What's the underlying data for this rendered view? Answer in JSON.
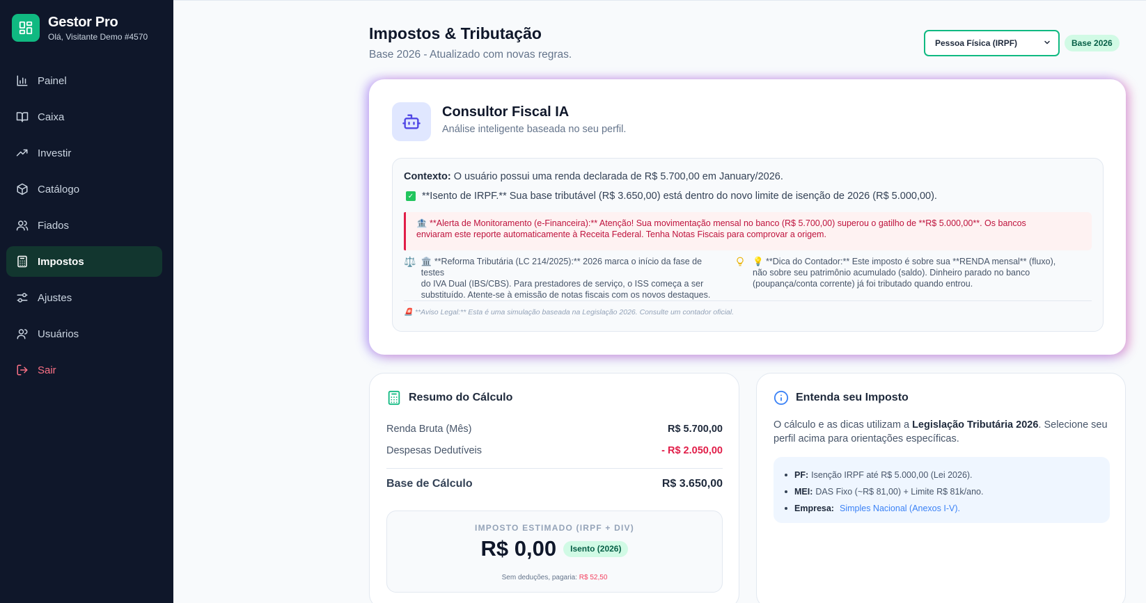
{
  "sidebar": {
    "brand_name": "Gestor Pro",
    "user_greeting": "Olá, Visitante Demo #4570",
    "items": [
      {
        "label": "Painel",
        "icon": "bar-chart-icon"
      },
      {
        "label": "Caixa",
        "icon": "book-icon"
      },
      {
        "label": "Investir",
        "icon": "trending-up-icon"
      },
      {
        "label": "Catálogo",
        "icon": "package-icon"
      },
      {
        "label": "Fiados",
        "icon": "users-icon"
      },
      {
        "label": "Impostos",
        "icon": "calculator-icon",
        "active": true
      },
      {
        "label": "Ajustes",
        "icon": "sliders-icon"
      },
      {
        "label": "Usuários",
        "icon": "user-icon"
      },
      {
        "label": "Sair",
        "icon": "logout-icon"
      }
    ]
  },
  "header": {
    "title": "Impostos & Tributação",
    "subtitle": "Base 2026 - Atualizado com novas regras.",
    "profile_select": "Pessoa Física (IRPF)",
    "base_badge": "Base 2026"
  },
  "ai": {
    "title": "Consultor Fiscal IA",
    "subtitle": "Análise inteligente baseada no seu perfil.",
    "context_label": "Contexto:",
    "context_text": "O usuário possui uma renda declarada de R$ 5.700,00 em January/2026.",
    "exempt_text": "**Isento de IRPF.** Sua base tributável (R$ 3.650,00) está dentro do novo limite de isenção de 2026 (R$ 5.000,00).",
    "alert_line1": "🏦 **Alerta de Monitoramento (e-Financeira):** Atenção! Sua movimentação mensal no banco (R$ 5.700,00) superou o gatilho de **R$ 5.000,00**. Os bancos",
    "alert_line2": "enviaram este reporte automaticamente à Receita Federal. Tenha Notas Fiscais para comprovar a origem.",
    "tip1_icon": "⚖️",
    "tip1_line1": "🏛️ **Reforma Tributária (LC 214/2025):** 2026 marca o início da fase de testes",
    "tip1_line2": "do IVA Dual (IBS/CBS). Para prestadores de serviço, o ISS começa a ser",
    "tip1_line3": "substituído. Atente-se à emissão de notas fiscais com os novos destaques.",
    "tip2_line1": "💡 **Dica do Contador:** Este imposto é sobre sua **RENDA mensal** (fluxo),",
    "tip2_line2": "não sobre seu patrimônio acumulado (saldo). Dinheiro parado no banco",
    "tip2_line3": "(poupança/conta corrente) já foi tributado quando entrou.",
    "legal": "🚨 **Aviso Legal:** Esta é uma simulação baseada na Legislação 2026. Consulte um contador oficial."
  },
  "summary": {
    "title": "Resumo do Cálculo",
    "gross_label": "Renda Bruta (Mês)",
    "gross_value": "R$ 5.700,00",
    "deductions_label": "Despesas Dedutíveis",
    "deductions_value": "- R$ 2.050,00",
    "base_label": "Base de Cálculo",
    "base_value": "R$ 3.650,00",
    "tax_label": "IMPOSTO ESTIMADO (IRPF + DIV)",
    "tax_value": "R$ 0,00",
    "tax_badge": "Isento (2026)",
    "no_deduction_label": "Sem deduções, pagaria:",
    "no_deduction_value": "R$ 52,50"
  },
  "explain": {
    "title": "Entenda seu Imposto",
    "text_before": "O cálculo e as dicas utilizam a",
    "text_bold": "Legislação Tributária 2026",
    "text_after": ". Selecione seu perfil acima para orientações específicas.",
    "items": [
      {
        "label": "PF:",
        "text": "Isenção IRPF até R$ 5.000,00 (Lei 2026)."
      },
      {
        "label": "MEI:",
        "text": "DAS Fixo (~R$ 81,00) + Limite R$ 81k/ano."
      },
      {
        "label": "Empresa:",
        "text": "Simples Nacional (Anexos I-V)."
      }
    ]
  },
  "colors": {
    "accent": "#10b981",
    "sidebar_bg": "#0f172a",
    "danger": "#e11d48"
  }
}
